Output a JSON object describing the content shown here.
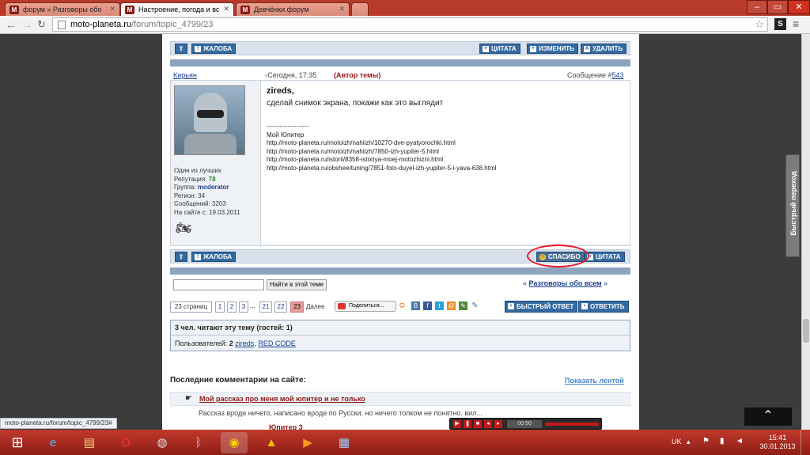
{
  "browser": {
    "tabs": [
      {
        "label": "форум » Разговоры обо"
      },
      {
        "label": "Настроение, погода и вс"
      },
      {
        "label": "Девчёнки форум"
      }
    ],
    "url_host": "moto-planeta.ru",
    "url_path": "/forum/topic_4799/23",
    "status_url": "moto-planeta.ru/forum/topic_4799/23#"
  },
  "post": {
    "top_buttons": {
      "complain": "ЖАЛОБА",
      "quote": "ЦИТАТА",
      "edit": "ИЗМЕНИТЬ",
      "delete": "УДАЛИТЬ"
    },
    "author": "Кирьян",
    "time": "Сегодня, 17:35",
    "author_tag": "(Автор темы)",
    "msg_label": "Сообщение #",
    "msg_num": "543",
    "addressee": "zireds",
    "text": "сделай снимок экрана, покажи как это выглядит",
    "signature_rule": "--------------------",
    "sig_title": "Мой Юпитер",
    "sig_links": [
      "http://moto-planeta.ru/motoizh/nahiizh/10270-dve-pyatyorochki.html",
      "http://moto-planeta.ru/motoizh/nahiizh/7850-izh-yupiter-5.html",
      "http://moto-planeta.ru/istorii/8358-istoriya-moej-motozhizni.html",
      "http://moto-planeta.ru/obshee/tuning/7851-foto-duyel-izh-yupiter-5-i-yava-638.html"
    ],
    "user": {
      "rank": "Один из лучших",
      "rep_label": "Репутация:",
      "rep": "78",
      "group_label": "Группа:",
      "group": "moderator",
      "region_label": "Регион:",
      "region": "34",
      "posts_label": "Сообщений:",
      "posts": "3203",
      "since_label": "На сайте с:",
      "since": "19.03.2011"
    },
    "bottom_buttons": {
      "complain": "ЖАЛОБА",
      "thanks": "СПАСИБО",
      "quote": "ЦИТАТА"
    }
  },
  "search": {
    "button": "Найти в этой теме",
    "nav_prev": "«",
    "forum_link": "Разговоры обо всем",
    "nav_next": "»"
  },
  "pagination": {
    "label": "23 страниц",
    "pages": [
      "1",
      "2",
      "3",
      "...",
      "21",
      "22",
      "23"
    ],
    "next": "Далее",
    "share": "Поделиться...",
    "quick_reply": "БЫСТРЫЙ ОТВЕТ",
    "reply": "ОТВЕТИТЬ"
  },
  "readers": {
    "title": "3 чел. читают эту тему (гостей: 1)",
    "users_label": "Пользователей:",
    "users_count": "2",
    "user1": "zireds",
    "user2": "RED CODE"
  },
  "comments": {
    "title": "Последние комментарии на сайте:",
    "show_feed": "Показать лентой",
    "item1_title": "Мой рассказ про меня мой юпитер и не только",
    "item1_text": "Рассказ вроде ничего, написано вроде по Русски, но ничего толком не понятно. вил...",
    "item2_title": "Юпитер 3"
  },
  "quick_nav": "Быстрый переход",
  "media": {
    "time": "00:50"
  },
  "taskbar": {
    "lang": "UK",
    "time": "15:41",
    "date": "30.01.2013"
  },
  "colors": {
    "accent_blue": "#356aa0",
    "header_bar": "#d9e1ec",
    "taskbar": "#b83a2a",
    "annotation": "#e8182b"
  }
}
